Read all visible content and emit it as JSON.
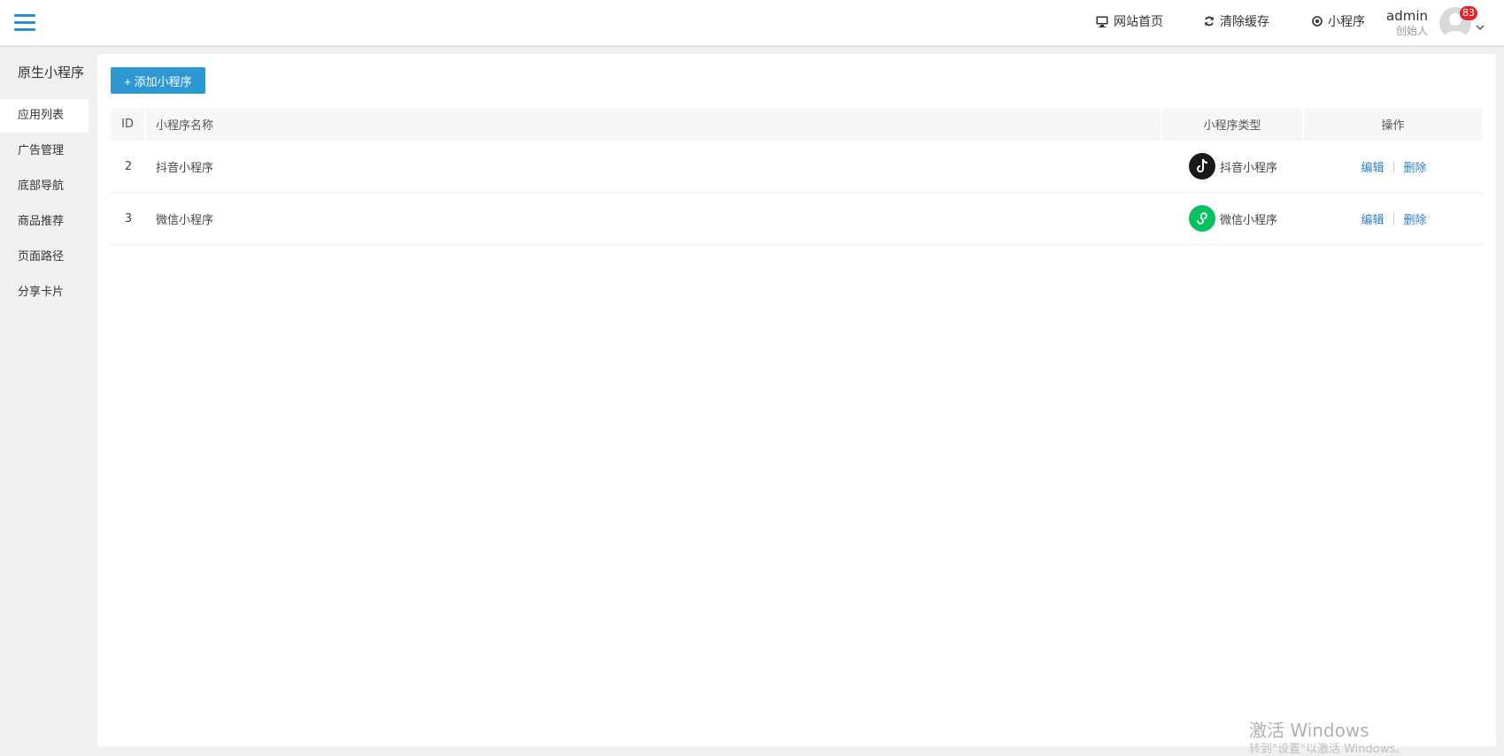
{
  "header": {
    "menu_icon": "hamburger-icon",
    "nav": [
      {
        "label": "网站首页",
        "icon": "monitor-icon"
      },
      {
        "label": "清除缓存",
        "icon": "refresh-icon"
      },
      {
        "label": "小程序",
        "icon": "compass-icon"
      }
    ],
    "user": {
      "name": "admin",
      "role": "创始人",
      "badge": "83"
    }
  },
  "sidebar": {
    "title": "原生小程序",
    "items": [
      {
        "label": "应用列表",
        "active": true
      },
      {
        "label": "广告管理"
      },
      {
        "label": "底部导航"
      },
      {
        "label": "商品推荐"
      },
      {
        "label": "页面路径"
      },
      {
        "label": "分享卡片"
      }
    ]
  },
  "main": {
    "add_button": "+ 添加小程序",
    "table": {
      "columns": [
        "ID",
        "小程序名称",
        "小程序类型",
        "操作"
      ],
      "rows": [
        {
          "id": "2",
          "name": "抖音小程序",
          "type": "抖音小程序",
          "type_icon": "tiktok-icon",
          "edit": "编辑",
          "delete": "删除"
        },
        {
          "id": "3",
          "name": "微信小程序",
          "type": "微信小程序",
          "type_icon": "wechat-miniprogram-icon",
          "edit": "编辑",
          "delete": "删除"
        }
      ]
    }
  },
  "watermark": {
    "line1": "激活 Windows",
    "line2": "转到\"设置\"以激活 Windows。"
  },
  "colors": {
    "accent": "#2d98d2",
    "link": "#2d7fc6",
    "badge": "#e0262d",
    "wechat": "#07c160",
    "tiktok": "#1a1a1a"
  }
}
